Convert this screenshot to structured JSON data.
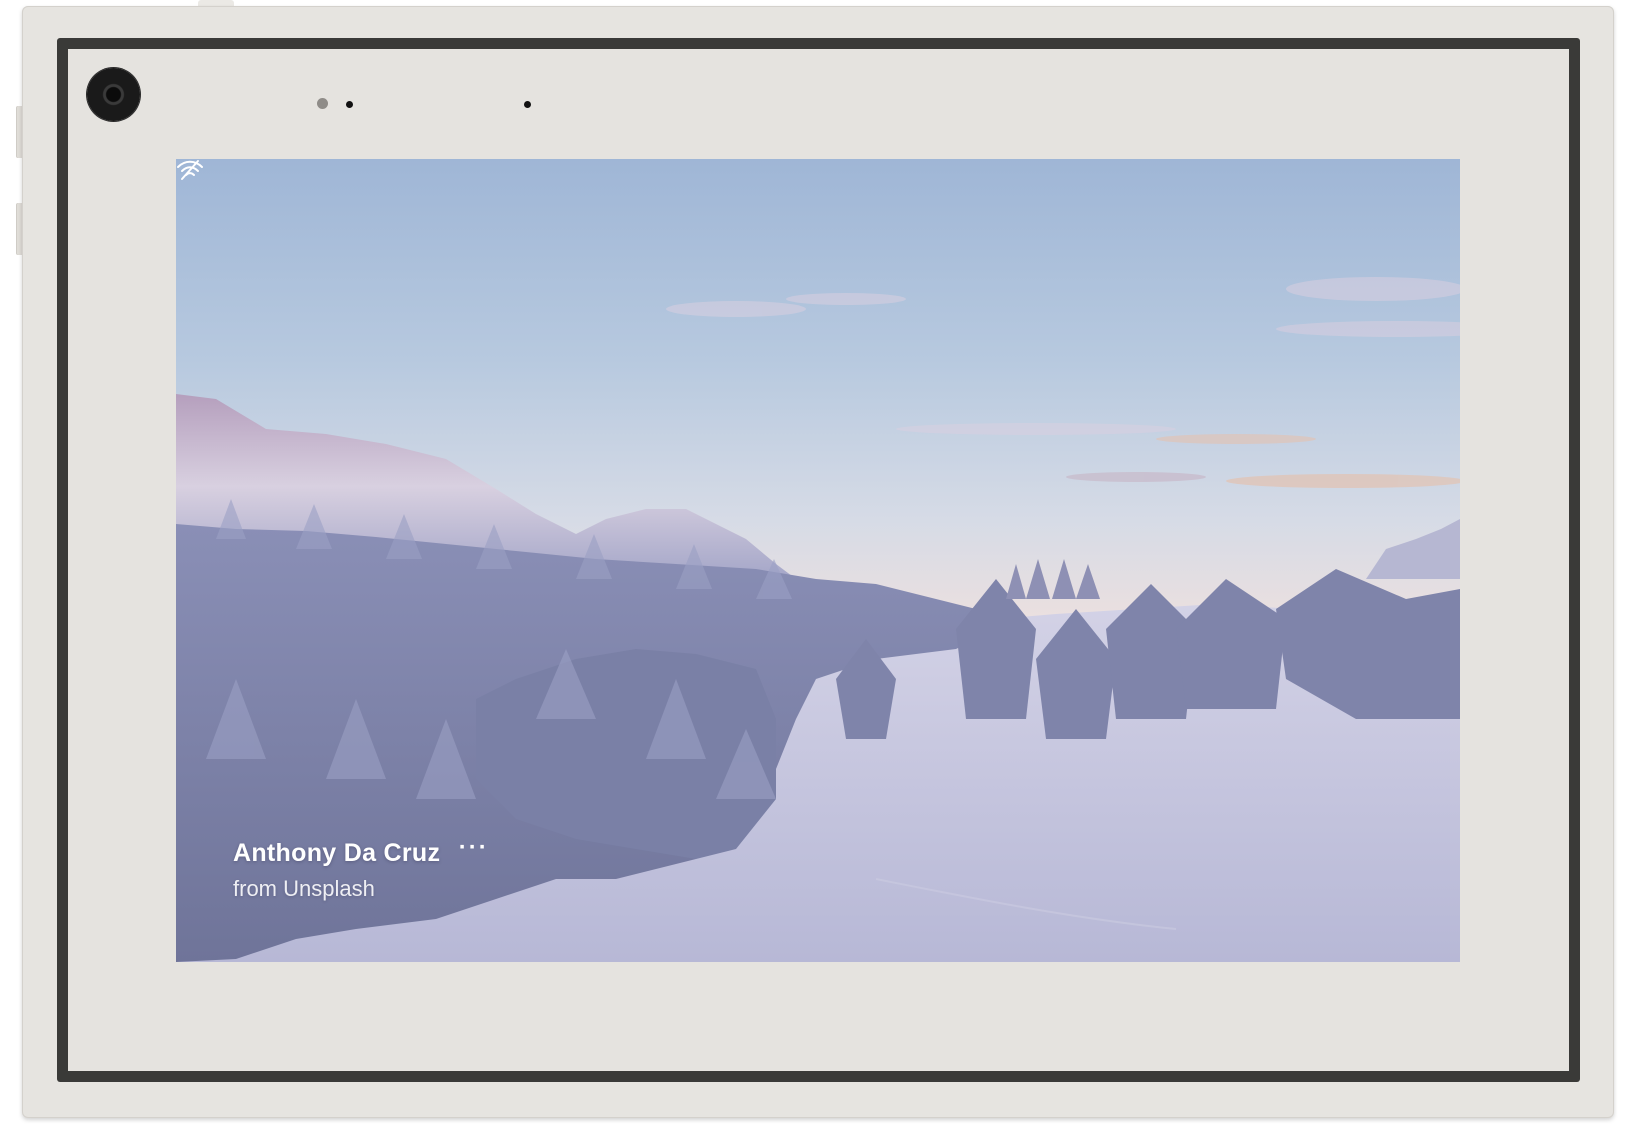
{
  "photo": {
    "author": "Anthony Da Cruz",
    "source": "from Unsplash",
    "more_label": "···"
  },
  "icons": {
    "connectivity": "wifi-off-icon",
    "camera": "camera-lens-icon"
  },
  "colors": {
    "device_body": "#e6e4e0",
    "frame": "#3a3a38",
    "sky_top": "#9fb6d6",
    "snow": "#c4c6de",
    "trees": "#7c82a8"
  }
}
